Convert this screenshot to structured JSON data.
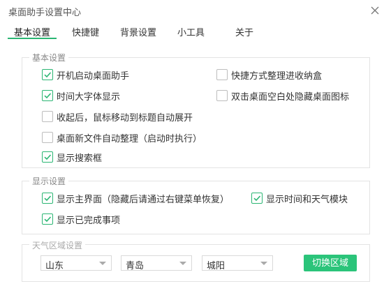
{
  "window": {
    "title": "桌面助手设置中心",
    "close_icon": "close-icon"
  },
  "tabs": [
    {
      "label": "基本设置",
      "active": true
    },
    {
      "label": "快捷键",
      "active": false
    },
    {
      "label": "背景设置",
      "active": false
    },
    {
      "label": "小工具",
      "active": false
    },
    {
      "label": "关于",
      "active": false
    }
  ],
  "basic": {
    "legend": "基本设置",
    "items": [
      {
        "label": "开机启动桌面助手",
        "checked": true
      },
      {
        "label": "快捷方式整理进收纳盒",
        "checked": false
      },
      {
        "label": "时间大字体显示",
        "checked": true
      },
      {
        "label": "双击桌面空白处隐藏桌面图标",
        "checked": false
      },
      {
        "label": "收起后，鼠标移动到标题自动展开",
        "checked": false
      },
      {
        "label": "桌面新文件自动整理（启动时执行）",
        "checked": false
      },
      {
        "label": "显示搜索框",
        "checked": true
      }
    ]
  },
  "display": {
    "legend": "显示设置",
    "items": [
      {
        "label": "显示主界面（隐藏后请通过右键菜单恢复）",
        "checked": true
      },
      {
        "label": "显示时间和天气模块",
        "checked": true
      },
      {
        "label": "显示已完成事项",
        "checked": true
      }
    ]
  },
  "weather": {
    "legend": "天气区域设置",
    "province": "山东",
    "city": "青岛",
    "district": "城阳",
    "switch_label": "切换区域"
  },
  "colors": {
    "accent": "#2bb673",
    "button": "#2bc47a"
  }
}
